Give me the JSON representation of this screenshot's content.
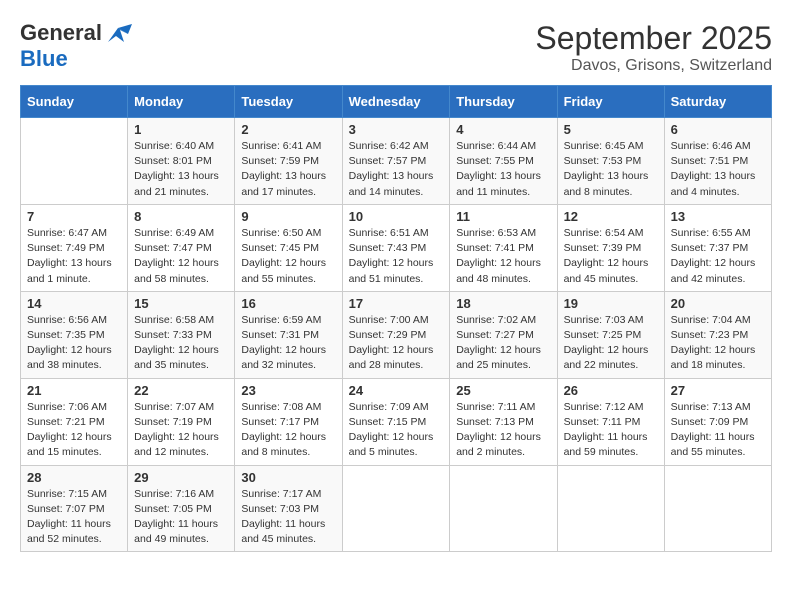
{
  "header": {
    "logo": {
      "general": "General",
      "blue": "Blue"
    },
    "title": "September 2025",
    "location": "Davos, Grisons, Switzerland"
  },
  "weekdays": [
    "Sunday",
    "Monday",
    "Tuesday",
    "Wednesday",
    "Thursday",
    "Friday",
    "Saturday"
  ],
  "weeks": [
    [
      {
        "day": "",
        "sunrise": "",
        "sunset": "",
        "daylight": ""
      },
      {
        "day": "1",
        "sunrise": "Sunrise: 6:40 AM",
        "sunset": "Sunset: 8:01 PM",
        "daylight": "Daylight: 13 hours and 21 minutes."
      },
      {
        "day": "2",
        "sunrise": "Sunrise: 6:41 AM",
        "sunset": "Sunset: 7:59 PM",
        "daylight": "Daylight: 13 hours and 17 minutes."
      },
      {
        "day": "3",
        "sunrise": "Sunrise: 6:42 AM",
        "sunset": "Sunset: 7:57 PM",
        "daylight": "Daylight: 13 hours and 14 minutes."
      },
      {
        "day": "4",
        "sunrise": "Sunrise: 6:44 AM",
        "sunset": "Sunset: 7:55 PM",
        "daylight": "Daylight: 13 hours and 11 minutes."
      },
      {
        "day": "5",
        "sunrise": "Sunrise: 6:45 AM",
        "sunset": "Sunset: 7:53 PM",
        "daylight": "Daylight: 13 hours and 8 minutes."
      },
      {
        "day": "6",
        "sunrise": "Sunrise: 6:46 AM",
        "sunset": "Sunset: 7:51 PM",
        "daylight": "Daylight: 13 hours and 4 minutes."
      }
    ],
    [
      {
        "day": "7",
        "sunrise": "Sunrise: 6:47 AM",
        "sunset": "Sunset: 7:49 PM",
        "daylight": "Daylight: 13 hours and 1 minute."
      },
      {
        "day": "8",
        "sunrise": "Sunrise: 6:49 AM",
        "sunset": "Sunset: 7:47 PM",
        "daylight": "Daylight: 12 hours and 58 minutes."
      },
      {
        "day": "9",
        "sunrise": "Sunrise: 6:50 AM",
        "sunset": "Sunset: 7:45 PM",
        "daylight": "Daylight: 12 hours and 55 minutes."
      },
      {
        "day": "10",
        "sunrise": "Sunrise: 6:51 AM",
        "sunset": "Sunset: 7:43 PM",
        "daylight": "Daylight: 12 hours and 51 minutes."
      },
      {
        "day": "11",
        "sunrise": "Sunrise: 6:53 AM",
        "sunset": "Sunset: 7:41 PM",
        "daylight": "Daylight: 12 hours and 48 minutes."
      },
      {
        "day": "12",
        "sunrise": "Sunrise: 6:54 AM",
        "sunset": "Sunset: 7:39 PM",
        "daylight": "Daylight: 12 hours and 45 minutes."
      },
      {
        "day": "13",
        "sunrise": "Sunrise: 6:55 AM",
        "sunset": "Sunset: 7:37 PM",
        "daylight": "Daylight: 12 hours and 42 minutes."
      }
    ],
    [
      {
        "day": "14",
        "sunrise": "Sunrise: 6:56 AM",
        "sunset": "Sunset: 7:35 PM",
        "daylight": "Daylight: 12 hours and 38 minutes."
      },
      {
        "day": "15",
        "sunrise": "Sunrise: 6:58 AM",
        "sunset": "Sunset: 7:33 PM",
        "daylight": "Daylight: 12 hours and 35 minutes."
      },
      {
        "day": "16",
        "sunrise": "Sunrise: 6:59 AM",
        "sunset": "Sunset: 7:31 PM",
        "daylight": "Daylight: 12 hours and 32 minutes."
      },
      {
        "day": "17",
        "sunrise": "Sunrise: 7:00 AM",
        "sunset": "Sunset: 7:29 PM",
        "daylight": "Daylight: 12 hours and 28 minutes."
      },
      {
        "day": "18",
        "sunrise": "Sunrise: 7:02 AM",
        "sunset": "Sunset: 7:27 PM",
        "daylight": "Daylight: 12 hours and 25 minutes."
      },
      {
        "day": "19",
        "sunrise": "Sunrise: 7:03 AM",
        "sunset": "Sunset: 7:25 PM",
        "daylight": "Daylight: 12 hours and 22 minutes."
      },
      {
        "day": "20",
        "sunrise": "Sunrise: 7:04 AM",
        "sunset": "Sunset: 7:23 PM",
        "daylight": "Daylight: 12 hours and 18 minutes."
      }
    ],
    [
      {
        "day": "21",
        "sunrise": "Sunrise: 7:06 AM",
        "sunset": "Sunset: 7:21 PM",
        "daylight": "Daylight: 12 hours and 15 minutes."
      },
      {
        "day": "22",
        "sunrise": "Sunrise: 7:07 AM",
        "sunset": "Sunset: 7:19 PM",
        "daylight": "Daylight: 12 hours and 12 minutes."
      },
      {
        "day": "23",
        "sunrise": "Sunrise: 7:08 AM",
        "sunset": "Sunset: 7:17 PM",
        "daylight": "Daylight: 12 hours and 8 minutes."
      },
      {
        "day": "24",
        "sunrise": "Sunrise: 7:09 AM",
        "sunset": "Sunset: 7:15 PM",
        "daylight": "Daylight: 12 hours and 5 minutes."
      },
      {
        "day": "25",
        "sunrise": "Sunrise: 7:11 AM",
        "sunset": "Sunset: 7:13 PM",
        "daylight": "Daylight: 12 hours and 2 minutes."
      },
      {
        "day": "26",
        "sunrise": "Sunrise: 7:12 AM",
        "sunset": "Sunset: 7:11 PM",
        "daylight": "Daylight: 11 hours and 59 minutes."
      },
      {
        "day": "27",
        "sunrise": "Sunrise: 7:13 AM",
        "sunset": "Sunset: 7:09 PM",
        "daylight": "Daylight: 11 hours and 55 minutes."
      }
    ],
    [
      {
        "day": "28",
        "sunrise": "Sunrise: 7:15 AM",
        "sunset": "Sunset: 7:07 PM",
        "daylight": "Daylight: 11 hours and 52 minutes."
      },
      {
        "day": "29",
        "sunrise": "Sunrise: 7:16 AM",
        "sunset": "Sunset: 7:05 PM",
        "daylight": "Daylight: 11 hours and 49 minutes."
      },
      {
        "day": "30",
        "sunrise": "Sunrise: 7:17 AM",
        "sunset": "Sunset: 7:03 PM",
        "daylight": "Daylight: 11 hours and 45 minutes."
      },
      {
        "day": "",
        "sunrise": "",
        "sunset": "",
        "daylight": ""
      },
      {
        "day": "",
        "sunrise": "",
        "sunset": "",
        "daylight": ""
      },
      {
        "day": "",
        "sunrise": "",
        "sunset": "",
        "daylight": ""
      },
      {
        "day": "",
        "sunrise": "",
        "sunset": "",
        "daylight": ""
      }
    ]
  ]
}
